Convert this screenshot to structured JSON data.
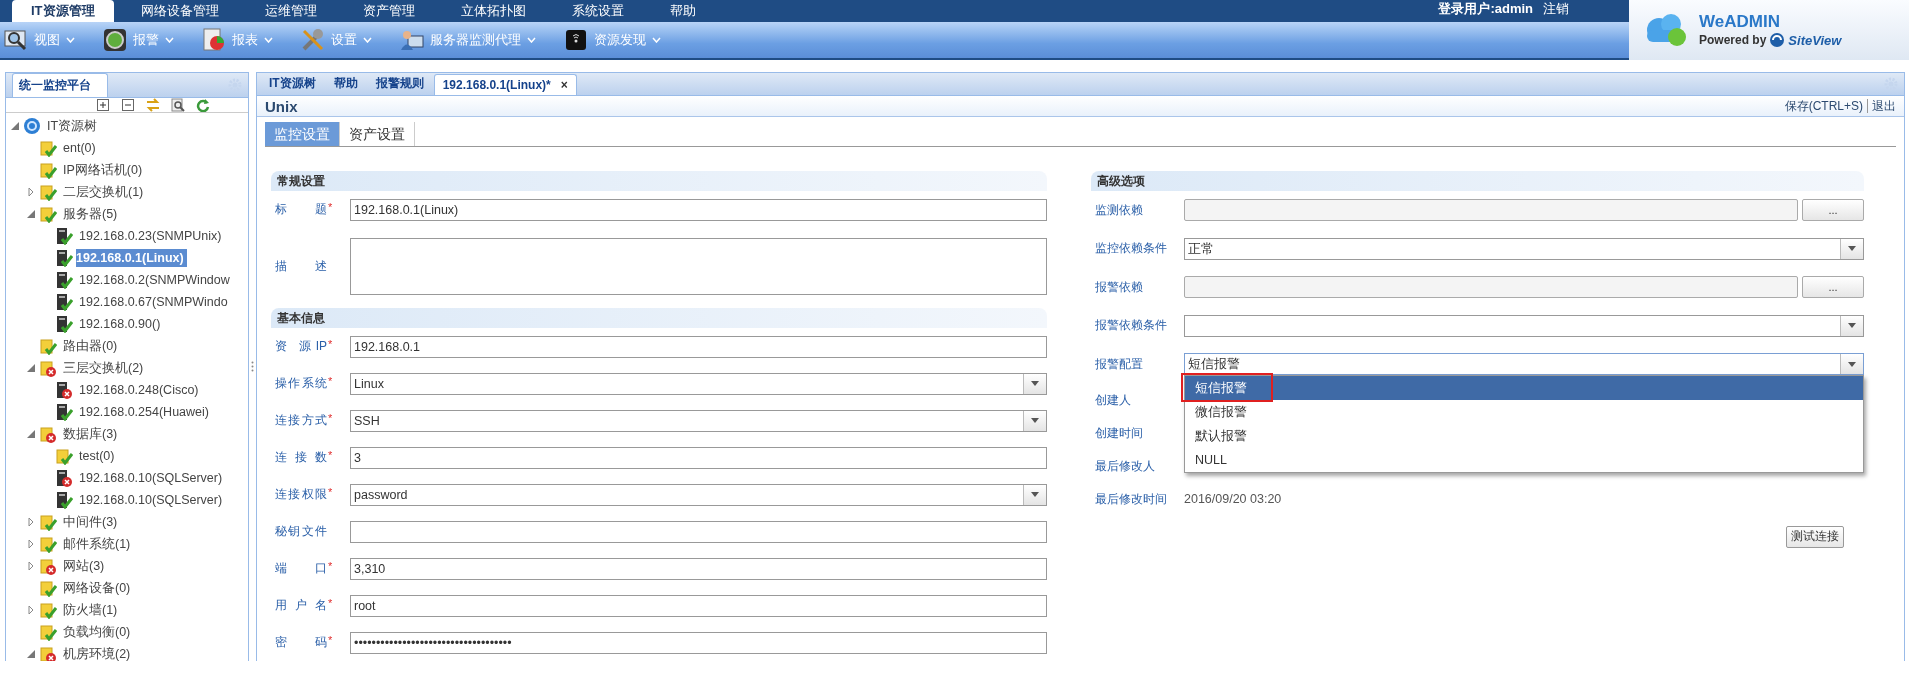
{
  "top_menu": [
    {
      "label": "IT资源管理",
      "selected": true
    },
    {
      "label": "网络设备管理",
      "selected": false
    },
    {
      "label": "运维管理",
      "selected": false
    },
    {
      "label": "资产管理",
      "selected": false
    },
    {
      "label": "立体拓扑图",
      "selected": false
    },
    {
      "label": "系统设置",
      "selected": false
    },
    {
      "label": "帮助",
      "selected": false
    }
  ],
  "login": {
    "user": "登录用户:admin",
    "logout": "注销"
  },
  "logo": {
    "name": "WeADMIN",
    "powered_by": "Powered by",
    "brand": "SiteView"
  },
  "toolbar": [
    {
      "label": "视图"
    },
    {
      "label": "报警"
    },
    {
      "label": "报表"
    },
    {
      "label": "设置"
    },
    {
      "label": "服务器监测代理"
    },
    {
      "label": "资源发现"
    }
  ],
  "left_panel": {
    "title": "统一监控平台",
    "tree": [
      {
        "label": "IT资源树",
        "kind": "root",
        "selected": false,
        "expanded": true,
        "children": [
          {
            "label": "ent(0)",
            "kind": "folder",
            "error": false,
            "selected": false
          },
          {
            "label": "IP网络话机(0)",
            "kind": "folder",
            "error": false,
            "selected": false
          },
          {
            "label": "二层交换机(1)",
            "kind": "folder",
            "error": false,
            "selected": false,
            "expanded": false
          },
          {
            "label": "服务器(5)",
            "kind": "folder",
            "error": false,
            "selected": false,
            "expanded": true,
            "children": [
              {
                "label": "192.168.0.23(SNMPUnix)",
                "kind": "server",
                "error": false,
                "selected": false
              },
              {
                "label": "192.168.0.1(Linux)",
                "kind": "server",
                "error": false,
                "selected": true
              },
              {
                "label": "192.168.0.2(SNMPWindow",
                "kind": "server",
                "error": false,
                "selected": false
              },
              {
                "label": "192.168.0.67(SNMPWindo",
                "kind": "server",
                "error": false,
                "selected": false
              },
              {
                "label": "192.168.0.90()",
                "kind": "server",
                "error": false,
                "selected": false
              }
            ]
          },
          {
            "label": "路由器(0)",
            "kind": "folder",
            "error": false,
            "selected": false
          },
          {
            "label": "三层交换机(2)",
            "kind": "folder",
            "error": true,
            "selected": false,
            "expanded": true,
            "children": [
              {
                "label": "192.168.0.248(Cisco)",
                "kind": "server",
                "error": true,
                "selected": false
              },
              {
                "label": "192.168.0.254(Huawei)",
                "kind": "server",
                "error": false,
                "selected": false
              }
            ]
          },
          {
            "label": "数据库(3)",
            "kind": "folder",
            "error": true,
            "selected": false,
            "expanded": true,
            "children": [
              {
                "label": "test(0)",
                "kind": "folder",
                "error": false,
                "selected": false
              },
              {
                "label": "192.168.0.10(SQLServer)",
                "kind": "server",
                "error": true,
                "selected": false
              },
              {
                "label": "192.168.0.10(SQLServer)",
                "kind": "server",
                "error": false,
                "selected": false
              }
            ]
          },
          {
            "label": "中间件(3)",
            "kind": "folder",
            "error": false,
            "selected": false,
            "expanded": false
          },
          {
            "label": "邮件系统(1)",
            "kind": "folder",
            "error": false,
            "selected": false,
            "expanded": false
          },
          {
            "label": "网站(3)",
            "kind": "folder",
            "error": true,
            "selected": false,
            "expanded": false
          },
          {
            "label": "网络设备(0)",
            "kind": "folder",
            "error": false,
            "selected": false
          },
          {
            "label": "防火墙(1)",
            "kind": "folder",
            "error": false,
            "selected": false,
            "expanded": false
          },
          {
            "label": "负载均衡(0)",
            "kind": "folder",
            "error": false,
            "selected": false
          },
          {
            "label": "机房环境(2)",
            "kind": "folder",
            "error": true,
            "selected": false,
            "expanded": true
          }
        ]
      }
    ]
  },
  "main_tabs": [
    {
      "label": "IT资源树",
      "selected": false,
      "closable": false
    },
    {
      "label": "帮助",
      "selected": false,
      "closable": false
    },
    {
      "label": "报警规则",
      "selected": false,
      "closable": false
    },
    {
      "label": "192.168.0.1(Linux)*",
      "selected": true,
      "closable": true,
      "close": "×"
    }
  ],
  "page": {
    "title": "Unix",
    "actions": [
      "保存(CTRL+S)",
      "退出"
    ],
    "subtabs": [
      {
        "label": "监控设置",
        "selected": true
      },
      {
        "label": "资产设置",
        "selected": false
      }
    ],
    "left_sections": [
      {
        "title": "常规设置",
        "fields": [
          {
            "label": "标 题",
            "mark": "*",
            "kind": "text",
            "value": "192.168.0.1(Linux)"
          },
          {
            "label": "描 述",
            "kind": "textarea"
          }
        ]
      },
      {
        "title": "基本信息",
        "fields": [
          {
            "label": "资 源IP",
            "mark": "*",
            "kind": "text",
            "value": "192.168.0.1"
          },
          {
            "label": "操作系统",
            "mark": "*",
            "kind": "select",
            "value": "Linux"
          },
          {
            "label": "连接方式",
            "mark": "*",
            "kind": "select",
            "value": "SSH"
          },
          {
            "label": "连 接 数",
            "mark": "*",
            "kind": "text",
            "value": "3"
          },
          {
            "label": "连接权限",
            "mark": "*",
            "kind": "select",
            "value": "password"
          },
          {
            "label": "秘钥文件",
            "kind": "text"
          },
          {
            "label": "端 口",
            "mark": "*",
            "kind": "text",
            "value": "3,310"
          },
          {
            "label": "用 户 名",
            "mark": "*",
            "kind": "text",
            "value": "root"
          },
          {
            "label": "密 码",
            "mark": "*",
            "kind": "text",
            "value": "••••••••••••••••••••••••••••••••••••"
          }
        ]
      }
    ],
    "right_section": {
      "title": "高级选项",
      "fields": [
        {
          "label": "监测依赖",
          "kind": "picker",
          "button": "..."
        },
        {
          "label": "监控依赖条件",
          "kind": "select",
          "value": "正常"
        },
        {
          "label": "报警依赖",
          "kind": "picker",
          "button": "..."
        },
        {
          "label": "报警依赖条件",
          "kind": "select"
        },
        {
          "label": "报警配置",
          "kind": "select",
          "value": "短信报警",
          "open": true,
          "options": [
            {
              "label": "短信报警",
              "selected": true,
              "marked": true
            },
            {
              "label": "微信报警",
              "selected": false,
              "marked": false
            },
            {
              "label": "默认报警",
              "selected": false,
              "marked": false
            },
            {
              "label": "NULL",
              "selected": false,
              "marked": false
            }
          ]
        },
        {
          "label": "创建人",
          "kind": "info"
        },
        {
          "label": "创建时间",
          "kind": "info"
        },
        {
          "label": "最后修改人",
          "kind": "info"
        },
        {
          "label": "最后修改时间",
          "kind": "info",
          "value": "2016/09/20 03:20"
        }
      ]
    },
    "test_button": "测试连接"
  }
}
